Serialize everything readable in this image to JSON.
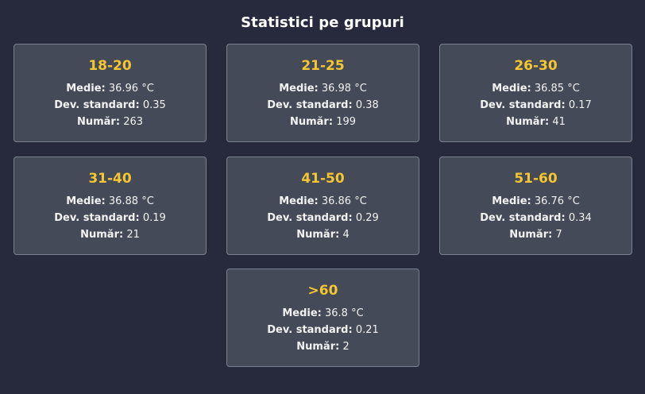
{
  "header": {
    "title": "Statistici pe grupuri"
  },
  "labels": {
    "mean": "Medie:",
    "std": "Dev. standard:",
    "count": "Număr:"
  },
  "groups": [
    {
      "range": "18-20",
      "mean": "36.96 °C",
      "std": "0.35",
      "count": "263"
    },
    {
      "range": "21-25",
      "mean": "36.98 °C",
      "std": "0.38",
      "count": "199"
    },
    {
      "range": "26-30",
      "mean": "36.85 °C",
      "std": "0.17",
      "count": "41"
    },
    {
      "range": "31-40",
      "mean": "36.88 °C",
      "std": "0.19",
      "count": "21"
    },
    {
      "range": "41-50",
      "mean": "36.86 °C",
      "std": "0.29",
      "count": "4"
    },
    {
      "range": "51-60",
      "mean": "36.76 °C",
      "std": "0.34",
      "count": "7"
    },
    {
      "range": ">60",
      "mean": "36.8 °C",
      "std": "0.21",
      "count": "2"
    }
  ],
  "colors": {
    "background": "#262a3c",
    "card": "#454a58",
    "card_border": "#7b8090",
    "accent": "#f4c62f"
  }
}
